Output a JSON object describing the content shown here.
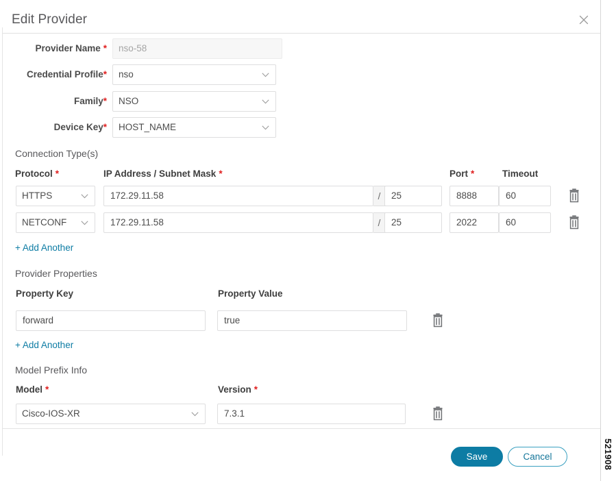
{
  "dialog": {
    "title": "Edit Provider",
    "close_icon": "close-icon"
  },
  "form": {
    "provider_name": {
      "label": "Provider Name",
      "required": "*",
      "value": "nso-58",
      "disabled": true
    },
    "credential_profile": {
      "label": "Credential Profile",
      "required": "*",
      "value": "nso"
    },
    "family": {
      "label": "Family",
      "required": "*",
      "value": "NSO"
    },
    "device_key": {
      "label": "Device Key",
      "required": "*",
      "value": "HOST_NAME"
    }
  },
  "connection_types": {
    "section_title": "Connection Type(s)",
    "headers": {
      "protocol": "Protocol",
      "protocol_required": "*",
      "ip_subnet": "IP Address / Subnet Mask",
      "ip_subnet_required": "*",
      "port": "Port",
      "port_required": "*",
      "timeout": "Timeout"
    },
    "separator": "/",
    "rows": [
      {
        "protocol": "HTTPS",
        "ip": "172.29.11.58",
        "subnet": "25",
        "port": "8888",
        "timeout": "60"
      },
      {
        "protocol": "NETCONF",
        "ip": "172.29.11.58",
        "subnet": "25",
        "port": "2022",
        "timeout": "60"
      }
    ],
    "add_another": "+ Add Another"
  },
  "provider_properties": {
    "section_title": "Provider Properties",
    "headers": {
      "key": "Property Key",
      "value": "Property Value"
    },
    "rows": [
      {
        "key": "forward",
        "value": "true"
      }
    ],
    "add_another": "+ Add Another"
  },
  "model_prefix_info": {
    "section_title": "Model Prefix Info",
    "headers": {
      "model": "Model",
      "model_required": "*",
      "version": "Version",
      "version_required": "*"
    },
    "rows": [
      {
        "model": "Cisco-IOS-XR",
        "version": "7.3.1"
      }
    ]
  },
  "footer": {
    "save_label": "Save",
    "cancel_label": "Cancel"
  },
  "figure_number": "521908",
  "colors": {
    "accent": "#0d7ca4",
    "required": "#e02020",
    "border": "#dededf",
    "title": "#58585b"
  }
}
